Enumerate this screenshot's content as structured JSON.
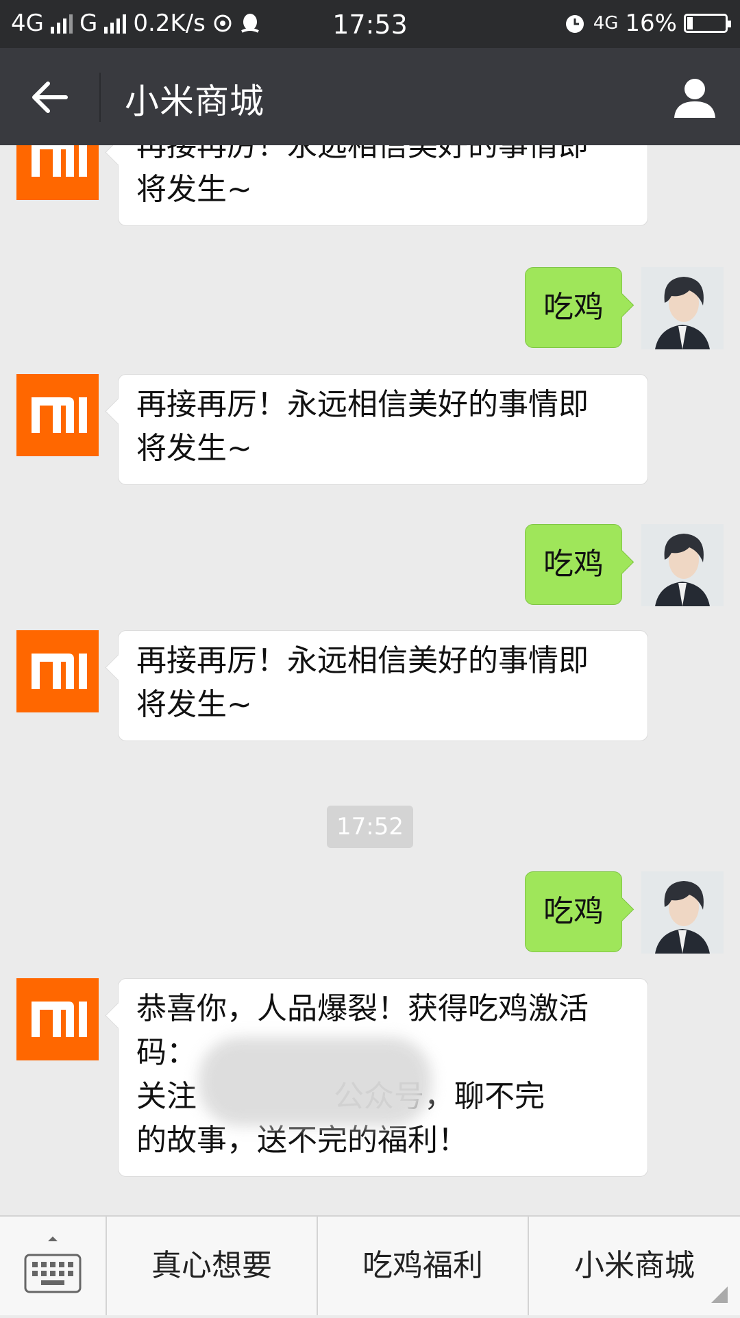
{
  "status_bar": {
    "network1": "4G",
    "network2": "G",
    "speed": "0.2K/s",
    "time": "17:53",
    "network3": "4G",
    "battery": "16%"
  },
  "title_bar": {
    "title": "小米商城"
  },
  "messages": [
    {
      "side": "left",
      "line1": "再接再厉！永远相信美好的事情即",
      "line2": "将发生~"
    },
    {
      "side": "right",
      "text": "吃鸡"
    },
    {
      "side": "left",
      "line1": "再接再厉！永远相信美好的事情即",
      "line2": "将发生~"
    },
    {
      "side": "right",
      "text": "吃鸡"
    },
    {
      "side": "left",
      "line1": "再接再厉！永远相信美好的事情即",
      "line2": "将发生~"
    },
    {
      "side": "time",
      "text": "17:52"
    },
    {
      "side": "right",
      "text": "吃鸡"
    },
    {
      "side": "left",
      "line1": "恭喜你，人品爆裂！获得吃鸡激活",
      "line2": "码：",
      "line3": "关注",
      "line3b": "公众号，聊不完",
      "line4": "的故事，送不完的福利！"
    }
  ],
  "bottom_menu": {
    "items": [
      "真心想要",
      "吃鸡福利",
      "小米商城"
    ]
  },
  "colors": {
    "status_bar_bg": "#2b2c2e",
    "title_bar_bg": "#393a3f",
    "chat_bg": "#ebebeb",
    "sent_bubble": "#9fe65a",
    "mi_orange": "#ff6700"
  },
  "icons": {
    "back": "arrow-left-icon",
    "user": "person-icon",
    "keyboard": "keyboard-icon",
    "mi_logo": "mi-logo-icon"
  }
}
